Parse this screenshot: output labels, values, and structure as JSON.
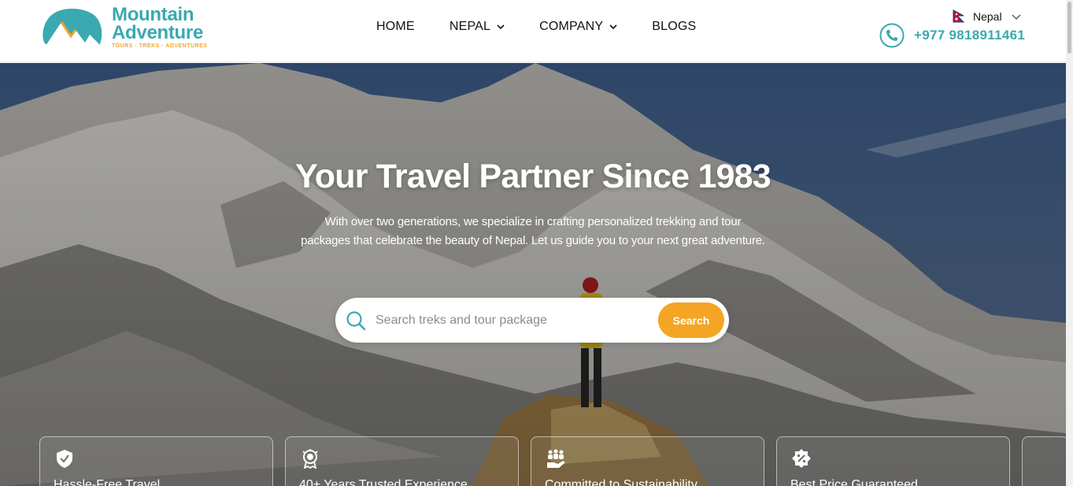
{
  "brand": {
    "line1": "Mountain",
    "line2": "Adventure",
    "tagline": "TOURS · TREKS · ADVENTURES",
    "primary_color": "#3aa9b0",
    "accent_color": "#f5a524"
  },
  "nav": {
    "items": [
      {
        "label": "HOME",
        "has_dropdown": false
      },
      {
        "label": "NEPAL",
        "has_dropdown": true
      },
      {
        "label": "COMPANY",
        "has_dropdown": true
      },
      {
        "label": "BLOGS",
        "has_dropdown": false
      }
    ]
  },
  "language": {
    "label": "Nepal",
    "icon": "nepal-flag-icon"
  },
  "contact": {
    "phone": "+977 9818911461",
    "icon": "phone-icon"
  },
  "hero": {
    "title": "Your Travel Partner Since 1983",
    "subtitle": "With over two generations, we specialize in crafting personalized trekking and tour packages that celebrate the beauty of Nepal. Let us guide you to your next great adventure."
  },
  "search": {
    "placeholder": "Search treks and tour package",
    "value": "",
    "button_label": "Search"
  },
  "features": [
    {
      "label": "Hassle-Free Travel",
      "icon": "shield-check-icon"
    },
    {
      "label": "40+ Years Trusted Experience",
      "icon": "award-badge-icon"
    },
    {
      "label": "Committed to Sustainability",
      "icon": "hands-community-icon"
    },
    {
      "label": "Best Price Guaranteed",
      "icon": "discount-badge-icon"
    }
  ]
}
